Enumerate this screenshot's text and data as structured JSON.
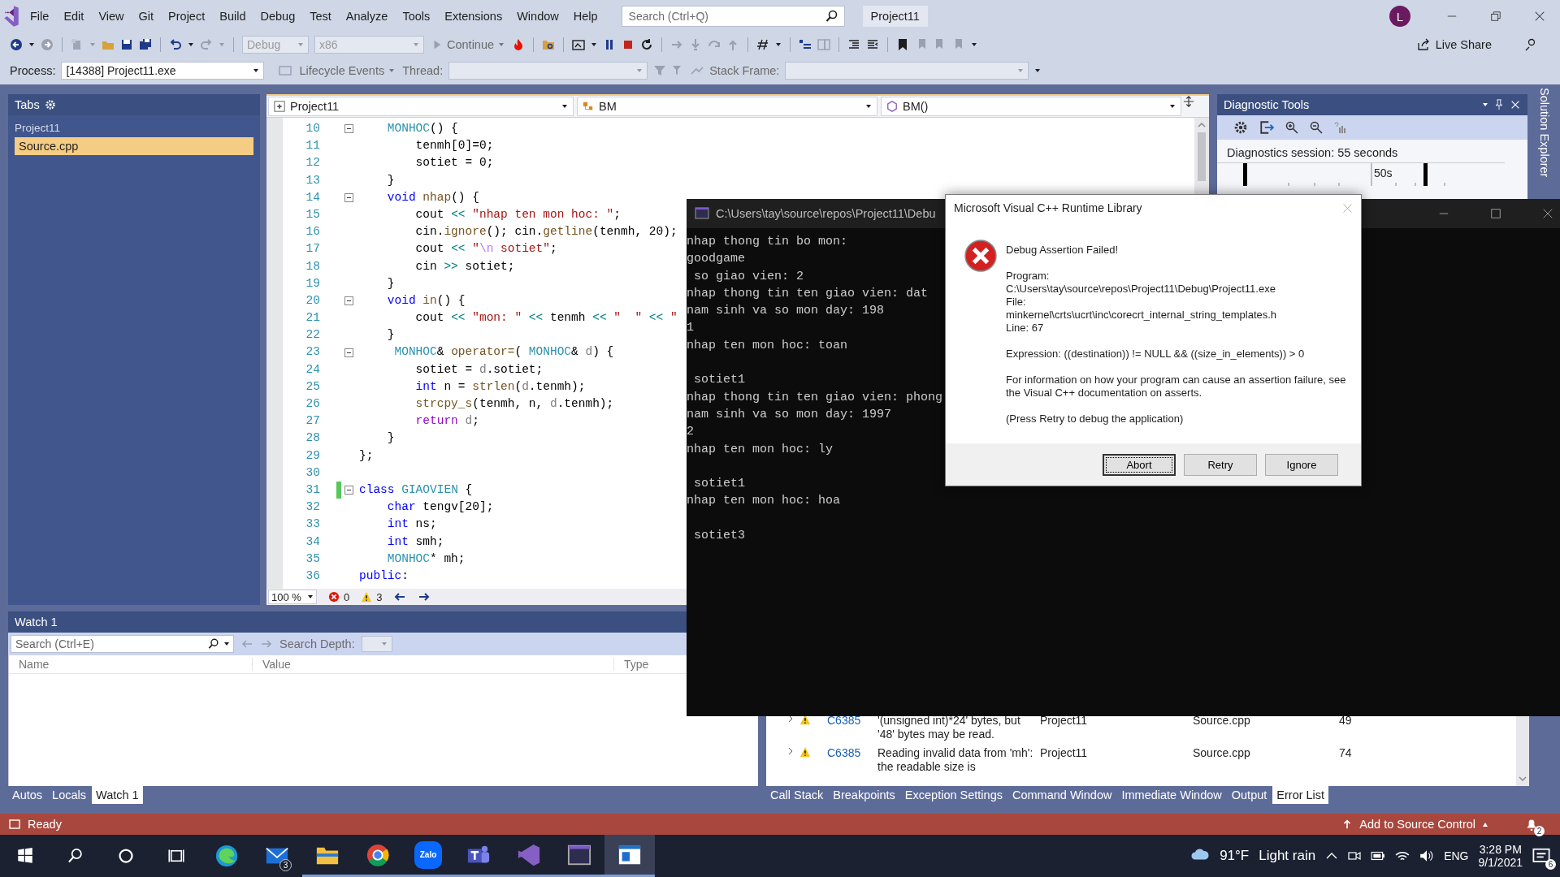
{
  "menu": [
    "File",
    "Edit",
    "View",
    "Git",
    "Project",
    "Build",
    "Debug",
    "Test",
    "Analyze",
    "Tools",
    "Extensions",
    "Window",
    "Help"
  ],
  "search": {
    "placeholder": "Search (Ctrl+Q)"
  },
  "title": "Project11",
  "account": {
    "initial": "L"
  },
  "toolbar": {
    "configuration": "Debug",
    "platform": "x86",
    "continue": "Continue",
    "live_share": "Live Share"
  },
  "debug_location": {
    "process_label": "Process:",
    "process": "[14388] Project11.exe",
    "lifecycle": "Lifecycle Events",
    "thread_label": "Thread:",
    "stack_frame_label": "Stack Frame:"
  },
  "tabs_panel": {
    "title": "Tabs",
    "groups": [
      {
        "name": "Project11",
        "files": [
          {
            "name": "Source.cpp",
            "selected": true
          }
        ]
      }
    ]
  },
  "editor": {
    "nav": [
      "Project11",
      "BM",
      "BM()"
    ],
    "lines": [
      {
        "n": "10",
        "fold": true,
        "changed": false,
        "tokens": [
          {
            "t": "    MONHOC",
            "kind": "type"
          },
          {
            "t": "() {",
            "kind": "plain"
          }
        ]
      },
      {
        "n": "11",
        "fold": false,
        "changed": false,
        "tokens": [
          {
            "t": "        tenmh[0]=0;",
            "kind": "plain"
          }
        ]
      },
      {
        "n": "12",
        "fold": false,
        "changed": false,
        "tokens": [
          {
            "t": "        sotiet = 0;",
            "kind": "plain"
          }
        ]
      },
      {
        "n": "13",
        "fold": false,
        "changed": false,
        "tokens": [
          {
            "t": "    }",
            "kind": "plain"
          }
        ]
      },
      {
        "n": "14",
        "fold": true,
        "changed": false,
        "tokens": [
          {
            "t": "    void",
            "kind": "keyword"
          },
          {
            "t": " nhap",
            "kind": "function"
          },
          {
            "t": "() {",
            "kind": "plain"
          }
        ]
      },
      {
        "n": "15",
        "fold": false,
        "changed": false,
        "tokens": [
          {
            "t": "        cout ",
            "kind": "plain"
          },
          {
            "t": "<<",
            "kind": "operator"
          },
          {
            "t": " \"nhap ten mon hoc: \"",
            "kind": "string"
          },
          {
            "t": ";",
            "kind": "plain"
          }
        ]
      },
      {
        "n": "16",
        "fold": false,
        "changed": false,
        "tokens": [
          {
            "t": "        cin.",
            "kind": "plain"
          },
          {
            "t": "ignore",
            "kind": "function"
          },
          {
            "t": "(); cin.",
            "kind": "plain"
          },
          {
            "t": "getline",
            "kind": "function"
          },
          {
            "t": "(tenmh, 20);",
            "kind": "plain"
          }
        ]
      },
      {
        "n": "17",
        "fold": false,
        "changed": false,
        "tokens": [
          {
            "t": "        cout ",
            "kind": "plain"
          },
          {
            "t": "<<",
            "kind": "operator"
          },
          {
            "t": " \"",
            "kind": "string"
          },
          {
            "t": "\\n",
            "kind": "escape"
          },
          {
            "t": " sotiet\"",
            "kind": "string"
          },
          {
            "t": ";",
            "kind": "plain"
          }
        ]
      },
      {
        "n": "18",
        "fold": false,
        "changed": false,
        "tokens": [
          {
            "t": "        cin ",
            "kind": "plain"
          },
          {
            "t": ">>",
            "kind": "operator"
          },
          {
            "t": " sotiet;",
            "kind": "plain"
          }
        ]
      },
      {
        "n": "19",
        "fold": false,
        "changed": false,
        "tokens": [
          {
            "t": "    }",
            "kind": "plain"
          }
        ]
      },
      {
        "n": "20",
        "fold": true,
        "changed": false,
        "tokens": [
          {
            "t": "    void",
            "kind": "keyword"
          },
          {
            "t": " in",
            "kind": "function"
          },
          {
            "t": "() {",
            "kind": "plain"
          }
        ]
      },
      {
        "n": "21",
        "fold": false,
        "changed": false,
        "tokens": [
          {
            "t": "        cout ",
            "kind": "plain"
          },
          {
            "t": "<<",
            "kind": "operator"
          },
          {
            "t": " \"mon: \"",
            "kind": "string"
          },
          {
            "t": " <<",
            "kind": "operator"
          },
          {
            "t": " tenmh ",
            "kind": "plain"
          },
          {
            "t": "<<",
            "kind": "operator"
          },
          {
            "t": " \"  \"",
            "kind": "string"
          },
          {
            "t": " <<",
            "kind": "operator"
          },
          {
            "t": " \"",
            "kind": "string"
          }
        ]
      },
      {
        "n": "22",
        "fold": false,
        "changed": false,
        "tokens": [
          {
            "t": "    }",
            "kind": "plain"
          }
        ]
      },
      {
        "n": "23",
        "fold": true,
        "changed": false,
        "tokens": [
          {
            "t": "     MONHOC",
            "kind": "type"
          },
          {
            "t": "& ",
            "kind": "plain"
          },
          {
            "t": "operator=",
            "kind": "function"
          },
          {
            "t": "( ",
            "kind": "plain"
          },
          {
            "t": "MONHOC",
            "kind": "type"
          },
          {
            "t": "& ",
            "kind": "plain"
          },
          {
            "t": "d",
            "kind": "param"
          },
          {
            "t": ") {",
            "kind": "plain"
          }
        ]
      },
      {
        "n": "24",
        "fold": false,
        "changed": false,
        "tokens": [
          {
            "t": "        sotiet = ",
            "kind": "plain"
          },
          {
            "t": "d",
            "kind": "param"
          },
          {
            "t": ".sotiet;",
            "kind": "plain"
          }
        ]
      },
      {
        "n": "25",
        "fold": false,
        "changed": false,
        "tokens": [
          {
            "t": "        int",
            "kind": "keyword"
          },
          {
            "t": " n = ",
            "kind": "plain"
          },
          {
            "t": "strlen",
            "kind": "function"
          },
          {
            "t": "(",
            "kind": "plain"
          },
          {
            "t": "d",
            "kind": "param"
          },
          {
            "t": ".tenmh);",
            "kind": "plain"
          }
        ]
      },
      {
        "n": "26",
        "fold": false,
        "changed": false,
        "tokens": [
          {
            "t": "        strcpy_s",
            "kind": "function"
          },
          {
            "t": "(tenmh, n, ",
            "kind": "plain"
          },
          {
            "t": "d",
            "kind": "param"
          },
          {
            "t": ".tenmh);",
            "kind": "plain"
          }
        ]
      },
      {
        "n": "27",
        "fold": false,
        "changed": false,
        "tokens": [
          {
            "t": "        return",
            "kind": "control"
          },
          {
            "t": " d",
            "kind": "param"
          },
          {
            "t": ";",
            "kind": "plain"
          }
        ]
      },
      {
        "n": "28",
        "fold": false,
        "changed": false,
        "tokens": [
          {
            "t": "    }",
            "kind": "plain"
          }
        ]
      },
      {
        "n": "29",
        "fold": false,
        "changed": false,
        "tokens": [
          {
            "t": "};",
            "kind": "plain"
          }
        ]
      },
      {
        "n": "30",
        "fold": false,
        "changed": false
      },
      {
        "n": "31",
        "fold": true,
        "changed": true,
        "tokens": [
          {
            "t": "class",
            "kind": "keyword"
          },
          {
            "t": " GIAOVIEN",
            "kind": "type"
          },
          {
            "t": " {",
            "kind": "plain"
          }
        ]
      },
      {
        "n": "32",
        "fold": false,
        "changed": false,
        "tokens": [
          {
            "t": "    char",
            "kind": "keyword"
          },
          {
            "t": " tengv[20];",
            "kind": "plain"
          }
        ]
      },
      {
        "n": "33",
        "fold": false,
        "changed": false,
        "tokens": [
          {
            "t": "    int",
            "kind": "keyword"
          },
          {
            "t": " ns;",
            "kind": "plain"
          }
        ]
      },
      {
        "n": "34",
        "fold": false,
        "changed": false,
        "tokens": [
          {
            "t": "    int",
            "kind": "keyword"
          },
          {
            "t": " smh;",
            "kind": "plain"
          }
        ]
      },
      {
        "n": "35",
        "fold": false,
        "changed": false,
        "tokens": [
          {
            "t": "    MONHOC",
            "kind": "type"
          },
          {
            "t": "* mh;",
            "kind": "plain"
          }
        ]
      },
      {
        "n": "36",
        "fold": false,
        "changed": false,
        "tokens": [
          {
            "t": "public",
            "kind": "keyword"
          },
          {
            "t": ":",
            "kind": "plain"
          }
        ]
      }
    ],
    "zoom": "100 %",
    "errors": "0",
    "warnings": "3"
  },
  "diagnostic_tools": {
    "title": "Diagnostic Tools",
    "session": "Diagnostics session: 55 seconds",
    "tick": "50s"
  },
  "side_tab": "Solution Explorer",
  "watch": {
    "title": "Watch 1",
    "search_placeholder": "Search (Ctrl+E)",
    "search_depth": "Search Depth:",
    "columns": [
      "Name",
      "Value",
      "Type"
    ],
    "tabs": [
      {
        "label": "Autos",
        "selected": false
      },
      {
        "label": "Locals",
        "selected": false
      },
      {
        "label": "Watch 1",
        "selected": true
      }
    ]
  },
  "error_list": {
    "rows": [
      {
        "code": "C6385",
        "description": "'(unsigned int)*24' bytes, but '48' bytes may be read.",
        "project": "Project11",
        "file": "Source.cpp",
        "line": "49"
      },
      {
        "code": "C6385",
        "description": "Reading invalid data from 'mh':  the readable size is",
        "project": "Project11",
        "file": "Source.cpp",
        "line": "74"
      }
    ],
    "tabs": [
      {
        "label": "Call Stack",
        "selected": false
      },
      {
        "label": "Breakpoints",
        "selected": false
      },
      {
        "label": "Exception Settings",
        "selected": false
      },
      {
        "label": "Command Window",
        "selected": false
      },
      {
        "label": "Immediate Window",
        "selected": false
      },
      {
        "label": "Output",
        "selected": false
      },
      {
        "label": "Error List",
        "selected": true
      }
    ]
  },
  "status_bar": {
    "text": "Ready",
    "source_control": "Add to Source Control",
    "notifications": "2"
  },
  "console": {
    "title": "C:\\Users\\tay\\source\\repos\\Project11\\Debu",
    "blocks": [
      [
        "nhap thong tin bo mon:",
        "goodgame",
        " so giao vien: 2",
        "nhap thong tin ten giao vien: dat",
        "nam sinh va so mon day: 198",
        "1",
        "nhap ten mon hoc: toan"
      ],
      [
        " sotiet1",
        "nhap thong tin ten giao vien: phong",
        "nam sinh va so mon day: 1997",
        "2",
        "nhap ten mon hoc: ly"
      ],
      [
        " sotiet1",
        "nhap ten mon hoc: hoa"
      ],
      [
        " sotiet3"
      ]
    ]
  },
  "dialog": {
    "title": "Microsoft Visual C++ Runtime Library",
    "heading": "Debug Assertion Failed!",
    "sections": [
      [
        "Program:",
        "C:\\Users\\tay\\source\\repos\\Project11\\Debug\\Project11.exe",
        "File:",
        "minkernel\\crts\\ucrt\\inc\\corecrt_internal_string_templates.h",
        "Line: 67"
      ],
      [
        "Expression: ((destination)) != NULL && ((size_in_elements)) > 0"
      ],
      [
        "For information on how your program can cause an assertion failure, see the Visual C++ documentation on asserts."
      ],
      [
        "(Press Retry to debug the application)"
      ]
    ],
    "buttons": [
      {
        "label": "Abort",
        "focused": true
      },
      {
        "label": "Retry",
        "focused": false
      },
      {
        "label": "Ignore",
        "focused": false
      }
    ]
  },
  "taskbar": {
    "mail_badge": "3",
    "zalo": "Zalo",
    "temperature": "91°F",
    "weather": "Light rain",
    "language": "ENG",
    "time": "3:28 PM",
    "date": "9/1/2021",
    "notifications": "6"
  }
}
